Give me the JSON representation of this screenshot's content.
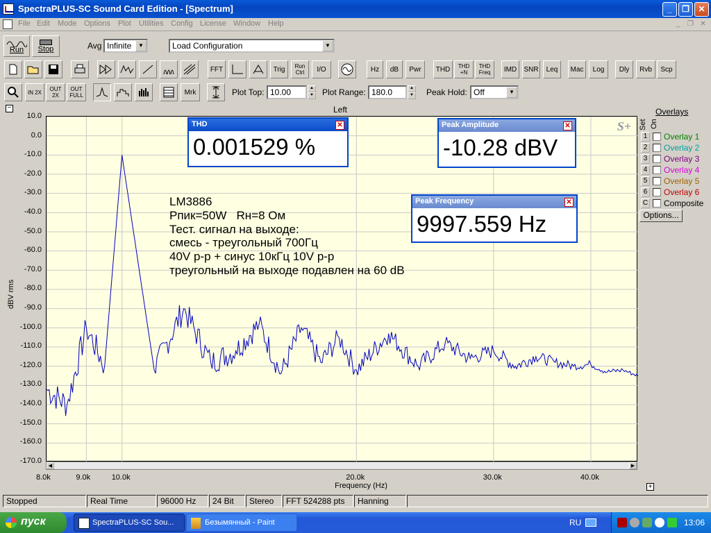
{
  "window": {
    "title": "SpectraPLUS-SC Sound Card Edition - [Spectrum]"
  },
  "menu": [
    "File",
    "Edit",
    "Mode",
    "Options",
    "Plot",
    "Utilities",
    "Config",
    "License",
    "Window",
    "Help"
  ],
  "controls": {
    "run": "Run",
    "stop": "Stop",
    "avg_label": "Avg",
    "avg_value": "Infinite",
    "config_value": "Load Configuration",
    "plot_top_label": "Plot Top:",
    "plot_top_value": "10.00",
    "plot_range_label": "Plot Range:",
    "plot_range_value": "180.0",
    "peak_hold_label": "Peak Hold:",
    "peak_hold_value": "Off"
  },
  "toolbar1": [
    "FFT",
    "Trig",
    "Run Ctrl",
    "I/O",
    "Hz",
    "dB",
    "Pwr",
    "THD",
    "THD +N",
    "THD Freq",
    "IMD",
    "SNR",
    "Leq",
    "Mac",
    "Log",
    "Dly",
    "Rvb",
    "Scp"
  ],
  "toolbar2": [
    "Mrk"
  ],
  "zoom_labels": [
    "IN 2X",
    "OUT 2X",
    "OUT FULL"
  ],
  "plot": {
    "channel": "Left",
    "xlabel": "Frequency (Hz)",
    "ylabel": "dBV rms",
    "logo": "S+",
    "yticks": [
      "10.0",
      "0.0",
      "-10.0",
      "-20.0",
      "-30.0",
      "-40.0",
      "-50.0",
      "-60.0",
      "-70.0",
      "-80.0",
      "-90.0",
      "-100.0",
      "-110.0",
      "-120.0",
      "-130.0",
      "-140.0",
      "-150.0",
      "-160.0",
      "-170.0"
    ],
    "xticks": [
      "8.0k",
      "9.0k",
      "10.0k",
      "20.0k",
      "30.0k",
      "40.0k"
    ]
  },
  "chart_data": {
    "type": "line",
    "xlabel": "Frequency (Hz)",
    "ylabel": "dBV rms",
    "ylim": [
      -170,
      10
    ],
    "xlim": [
      8000,
      46000
    ],
    "xscale": "log",
    "series": [
      {
        "x": [
          8000,
          8500,
          9000,
          9500,
          10000,
          11000,
          12000,
          13000,
          14000,
          15000,
          16000,
          17000,
          18000,
          19000,
          20000,
          22000,
          24000,
          26000,
          28000,
          30000,
          32000,
          34000,
          36000,
          38000,
          40000,
          42000,
          44000,
          46000
        ],
        "y": [
          -132,
          -140,
          -100,
          -120,
          -10,
          -122,
          -90,
          -118,
          -112,
          -98,
          -124,
          -100,
          -118,
          -105,
          -122,
          -103,
          -120,
          -108,
          -116,
          -112,
          -120,
          -115,
          -118,
          -120,
          -119,
          -123,
          -122,
          -125
        ]
      }
    ]
  },
  "popups": {
    "thd_title": "THD",
    "thd_value": "0.001529 %",
    "amp_title": "Peak Amplitude",
    "amp_value": "-10.28 dBV",
    "freq_title": "Peak Frequency",
    "freq_value": "9997.559 Hz"
  },
  "annotation": [
    "LM3886",
    "Рпик=50W   Rн=8 Ом",
    "Тест. сигнал на выходе:",
    "смесь - треугольный 700Гц",
    "40V p-p + синус 10кГц 10V p-p",
    "треугольный на выходе подавлен на 60 dB"
  ],
  "overlays": {
    "title": "Overlays",
    "set": "Set",
    "on": "On",
    "items": [
      {
        "num": "1",
        "name": "Overlay 1",
        "color": "#008000"
      },
      {
        "num": "2",
        "name": "Overlay 2",
        "color": "#00a0a0"
      },
      {
        "num": "3",
        "name": "Overlay 3",
        "color": "#800080"
      },
      {
        "num": "4",
        "name": "Overlay 4",
        "color": "#e000e0"
      },
      {
        "num": "5",
        "name": "Overlay 5",
        "color": "#a06000"
      },
      {
        "num": "6",
        "name": "Overlay 6",
        "color": "#c00000"
      },
      {
        "num": "C",
        "name": "Composite",
        "color": "#000000"
      }
    ],
    "options": "Options..."
  },
  "status": [
    "Stopped",
    "Real Time",
    "96000 Hz",
    "24 Bit",
    "Stereo",
    "FFT 524288 pts",
    "Hanning"
  ],
  "taskbar": {
    "start": "пуск",
    "tasks": [
      "SpectraPLUS-SC Sou...",
      "Безымянный - Paint"
    ],
    "lang": "RU",
    "time": "13:06"
  },
  "colors": {
    "trace": "#0000c0",
    "plot_bg": "#ffffe1"
  }
}
